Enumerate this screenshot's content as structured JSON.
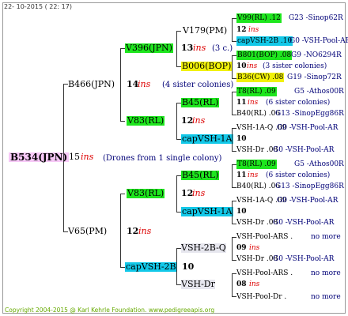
{
  "header": {
    "date": "22- 10-2015 ( 22: 17)"
  },
  "footer": {
    "copyright": "Copyright 2004-2015 @ Karl Kehrle Foundation.   www.pedigreeapis.org"
  },
  "root": {
    "name": "B534(JPN)",
    "num": "15",
    "ins": "ins",
    "note": "(Drones from 1 single colony)"
  },
  "gen1": {
    "sire": {
      "name": "B466(JPN)",
      "num": "14",
      "ins": "ins",
      "note": "(4 sister colonies)"
    },
    "dam": {
      "name": "V65(PM)",
      "num": "12",
      "ins": "ins"
    }
  },
  "gen2": {
    "a": {
      "name": "V396(JPN)",
      "num": "13",
      "ins": "ins",
      "note": "(3 c.)"
    },
    "b": {
      "name": "V83(RL)",
      "num": "12",
      "ins": "ins"
    },
    "c": {
      "name": "V83(RL)",
      "num": "12",
      "ins": "ins"
    },
    "d": {
      "name": "capVSH-2B",
      "num": "10"
    }
  },
  "gen3": {
    "a1": {
      "name": "V179(PM)"
    },
    "a2": {
      "name": "B006(BOP)",
      "num": "10",
      "ins": "ins"
    },
    "b1": {
      "name": "B45(RL)",
      "num": "11",
      "ins": "ins"
    },
    "b2": {
      "name": "capVSH-1A",
      "num": "10"
    },
    "c1": {
      "name": "B45(RL)",
      "num": "11",
      "ins": "ins"
    },
    "c2": {
      "name": "capVSH-1A",
      "num": "10"
    },
    "d1": {
      "name": "VSH-2B-Q",
      "num": "09",
      "ins": "ins"
    },
    "d2": {
      "name": "VSH-Dr",
      "num": "08",
      "ins": "ins"
    }
  },
  "gen4": [
    {
      "left": "V99(RL) .12",
      "right": "G23 -Sinop62R"
    },
    {
      "left": "12",
      "ins": "ins"
    },
    {
      "left": "capVSH-2B .10",
      "right": "G0 -VSH-Pool-AR"
    },
    {
      "left": "B801(BOP) .08",
      "right": "G9 -NO6294R"
    },
    {
      "left": "10",
      "ins": "ins",
      "note": "(3 sister colonies)"
    },
    {
      "left": "B36(CW) .08",
      "right": "G19 -Sinop72R"
    },
    {
      "left": "T8(RL) .09",
      "right": "G5 -Athos00R"
    },
    {
      "left": "11",
      "ins": "ins",
      "note": "(6 sister colonies)"
    },
    {
      "left": "B40(RL) .06",
      "right": "G13 -SinopEgg86R"
    },
    {
      "left": "VSH-1A-Q .09",
      "right": "G0 -VSH-Pool-AR"
    },
    {
      "left": "10"
    },
    {
      "left": "VSH-Dr .08",
      "right": "G0 -VSH-Pool-AR"
    },
    {
      "left": "T8(RL) .09",
      "right": "G5 -Athos00R"
    },
    {
      "left": "11",
      "ins": "ins",
      "note": "(6 sister colonies)"
    },
    {
      "left": "B40(RL) .06",
      "right": "G13 -SinopEgg86R"
    },
    {
      "left": "VSH-1A-Q .09",
      "right": "G0 -VSH-Pool-AR"
    },
    {
      "left": "10"
    },
    {
      "left": "VSH-Dr .08",
      "right": "G0 -VSH-Pool-AR"
    },
    {
      "left": "VSH-Pool-ARS .",
      "right": "no more"
    },
    {
      "left": "09",
      "ins": "ins"
    },
    {
      "left": "VSH-Dr .08",
      "right": "G0 -VSH-Pool-AR"
    },
    {
      "left": "VSH-Pool-ARS .",
      "right": "no more"
    },
    {
      "left": "08",
      "ins": "ins"
    },
    {
      "left": "VSH-Pool-Dr .",
      "right": "no more"
    }
  ]
}
